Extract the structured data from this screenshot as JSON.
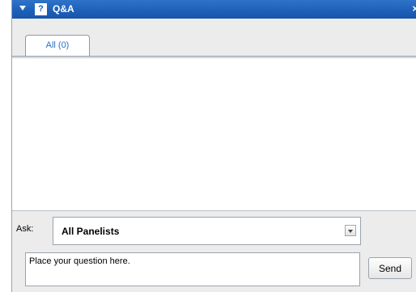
{
  "titlebar": {
    "title": "Q&A",
    "question_icon": "?",
    "close_glyph": "×"
  },
  "tabs": [
    {
      "label": "All (0)",
      "selected": true
    }
  ],
  "ask": {
    "label": "Ask:",
    "selected": "All Panelists"
  },
  "question": {
    "placeholder": "Place your question here."
  },
  "send": {
    "label": "Send"
  },
  "colors": {
    "titlebar": "#1c5fb8",
    "tab_text": "#2b6ec7",
    "panel_bg": "#ececec"
  }
}
